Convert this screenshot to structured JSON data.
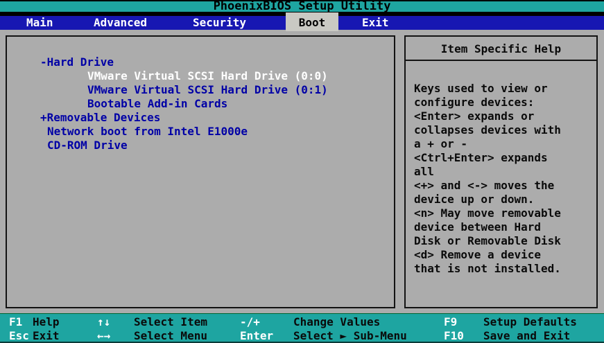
{
  "window": {
    "title": "PhoenixBIOS Setup Utility"
  },
  "menu": {
    "tabs": [
      {
        "label": "Main",
        "selected": false
      },
      {
        "label": "Advanced",
        "selected": false
      },
      {
        "label": "Security",
        "selected": false
      },
      {
        "label": "Boot",
        "selected": true
      },
      {
        "label": "Exit",
        "selected": false
      }
    ]
  },
  "boot_list": {
    "items": [
      {
        "text": "-Hard Drive",
        "selected": false
      },
      {
        "text": "VMware Virtual SCSI Hard Drive (0:0)",
        "selected": true
      },
      {
        "text": "VMware Virtual SCSI Hard Drive (0:1)",
        "selected": false
      },
      {
        "text": "Bootable Add-in Cards",
        "selected": false
      },
      {
        "text": "+Removable Devices",
        "selected": false
      },
      {
        "text": "Network boot from Intel E1000e",
        "selected": false
      },
      {
        "text": "CD-ROM Drive",
        "selected": false
      }
    ]
  },
  "help": {
    "title": "Item Specific Help",
    "lines": [
      "Keys used to view or",
      "configure devices:",
      "<Enter> expands or",
      "collapses devices with",
      "a + or -",
      "<Ctrl+Enter> expands",
      "all",
      "<+> and <-> moves the",
      "device up or down.",
      "<n> May move removable",
      "device between Hard",
      "Disk or Removable Disk",
      "<d> Remove a device",
      "that is not installed."
    ]
  },
  "legend": {
    "rows": [
      [
        {
          "key": "F1",
          "desc": "Help"
        },
        {
          "key": "↑↓",
          "desc": "Select Item"
        },
        {
          "key": "-/+",
          "desc": "Change Values"
        },
        {
          "key": "F9",
          "desc": "Setup Defaults"
        }
      ],
      [
        {
          "key": "Esc",
          "desc": "Exit"
        },
        {
          "key": "←→",
          "desc": "Select Menu"
        },
        {
          "key": "Enter",
          "desc": "Select ► Sub-Menu"
        },
        {
          "key": "F10",
          "desc": "Save and Exit"
        }
      ]
    ]
  },
  "colors": {
    "teal": "#1ea5a1",
    "menu_blue": "#1717b2",
    "item_navy": "#0000a6",
    "panel_gray": "#acacac",
    "selected_tab": "#c9c9c3",
    "selected_item": "#ffffff",
    "text": "#0a0a0a"
  }
}
